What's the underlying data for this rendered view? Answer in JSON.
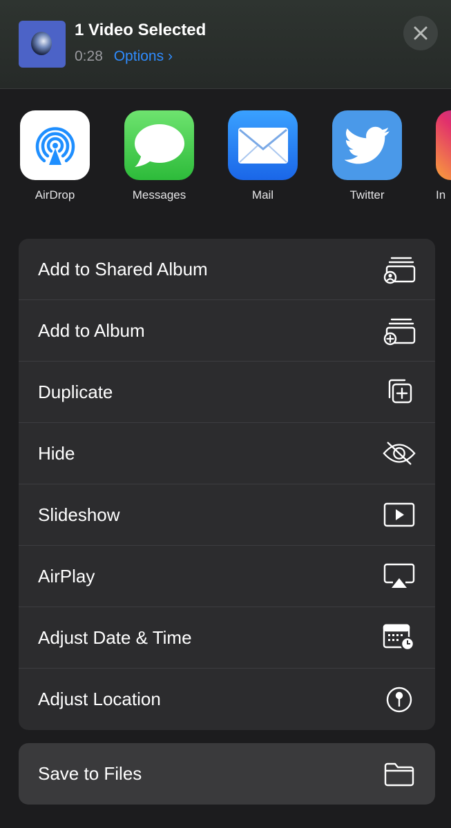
{
  "header": {
    "title": "1 Video Selected",
    "duration": "0:28",
    "options_label": "Options",
    "options_chevron": "›",
    "close_icon": "close-icon"
  },
  "apps": [
    {
      "label": "AirDrop",
      "icon": "airdrop-icon",
      "color": "#ffffff"
    },
    {
      "label": "Messages",
      "icon": "messages-icon",
      "color": "#34c759"
    },
    {
      "label": "Mail",
      "icon": "mail-icon",
      "color": "#2f7cf6"
    },
    {
      "label": "Twitter",
      "icon": "twitter-icon",
      "color": "#4a99e9"
    },
    {
      "label": "In",
      "icon": "instagram-icon",
      "color": "#c13584"
    }
  ],
  "actions": [
    {
      "label": "Add to Shared Album",
      "icon": "shared-album-icon"
    },
    {
      "label": "Add to Album",
      "icon": "add-album-icon"
    },
    {
      "label": "Duplicate",
      "icon": "duplicate-icon"
    },
    {
      "label": "Hide",
      "icon": "eye-slash-icon"
    },
    {
      "label": "Slideshow",
      "icon": "play-icon"
    },
    {
      "label": "AirPlay",
      "icon": "airplay-icon"
    },
    {
      "label": "Adjust Date & Time",
      "icon": "calendar-clock-icon"
    },
    {
      "label": "Adjust Location",
      "icon": "location-pin-icon"
    }
  ],
  "secondary_actions": [
    {
      "label": "Save to Files",
      "icon": "folder-icon"
    }
  ],
  "colors": {
    "accent": "#2f8cff",
    "background": "#1c1c1e",
    "card": "#2c2c2e"
  }
}
